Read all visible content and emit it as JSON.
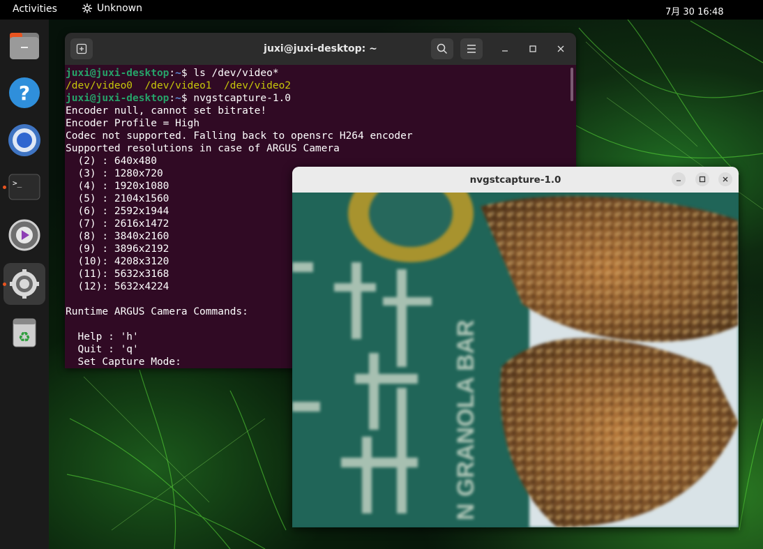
{
  "topbar": {
    "activities": "Activities",
    "app_indicator": "Unknown",
    "clock": "7月 30  16:48"
  },
  "dock": {
    "items": [
      {
        "name": "files",
        "icon": "files-icon"
      },
      {
        "name": "help",
        "icon": "help-icon"
      },
      {
        "name": "chromium",
        "icon": "chromium-icon"
      },
      {
        "name": "terminal",
        "icon": "terminal-icon",
        "running": true
      },
      {
        "name": "software-settings",
        "icon": "software-settings-icon"
      },
      {
        "name": "settings",
        "icon": "gear-icon",
        "running": true,
        "active": true
      },
      {
        "name": "trash",
        "icon": "trash-icon"
      }
    ]
  },
  "terminal": {
    "title": "juxi@juxi-desktop: ~",
    "prompt_user": "juxi@juxi-desktop",
    "prompt_path": "~",
    "command1": "$ ls /dev/video*",
    "devices": [
      "/dev/video0",
      "/dev/video1",
      "/dev/video2"
    ],
    "command2": "$ nvgstcapture-1.0",
    "output_lines": [
      "Encoder null, cannot set bitrate!",
      "Encoder Profile = High",
      "Codec not supported. Falling back to opensrc H264 encoder",
      "Supported resolutions in case of ARGUS Camera",
      "  (2) : 640x480",
      "  (3) : 1280x720",
      "  (4) : 1920x1080",
      "  (5) : 2104x1560",
      "  (6) : 2592x1944",
      "  (7) : 2616x1472",
      "  (8) : 3840x2160",
      "  (9) : 3896x2192",
      "  (10): 4208x3120",
      "  (11): 5632x3168",
      "  (12): 5632x4224",
      "",
      "Runtime ARGUS Camera Commands:",
      "",
      "  Help : 'h'",
      "  Quit : 'q'",
      "  Set Capture Mode:"
    ]
  },
  "capture": {
    "title": "nvgstcapture-1.0",
    "video_text": "N GRANOLA BAR"
  },
  "colors": {
    "terminal_bg": "#300a24",
    "prompt_green": "#26a269",
    "prompt_blue": "#5c8ad6",
    "device_yellow": "#c6c60a",
    "accent_orange": "#e95420"
  }
}
